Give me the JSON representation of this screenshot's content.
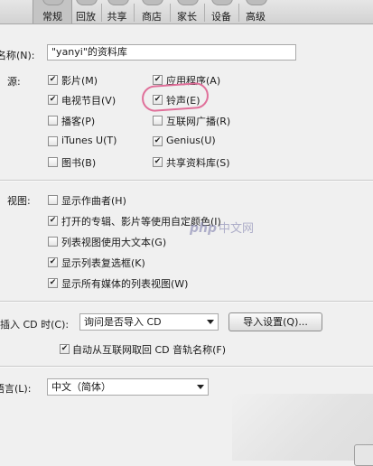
{
  "toolbar": {
    "tabs": [
      {
        "label": "常规",
        "icon": "gear-icon"
      },
      {
        "label": "回放",
        "icon": "playback-icon"
      },
      {
        "label": "共享",
        "icon": "share-icon"
      },
      {
        "label": "商店",
        "icon": "store-icon"
      },
      {
        "label": "家长",
        "icon": "parental-icon"
      },
      {
        "label": "设备",
        "icon": "device-icon"
      },
      {
        "label": "高级",
        "icon": "advanced-icon"
      }
    ],
    "active": "常规"
  },
  "library_name": {
    "label": "名称(N):",
    "value": "\"yanyi\"的资料库"
  },
  "sources": {
    "label": "源:",
    "items": [
      {
        "label": "影片(M)",
        "checked": true
      },
      {
        "label": "应用程序(A)",
        "checked": true
      },
      {
        "label": "电视节目(V)",
        "checked": true
      },
      {
        "label": "铃声(E)",
        "checked": true
      },
      {
        "label": "播客(P)",
        "checked": false
      },
      {
        "label": "互联网广播(R)",
        "checked": false
      },
      {
        "label": "iTunes U(T)",
        "checked": false
      },
      {
        "label": "Genius(U)",
        "checked": true
      },
      {
        "label": "图书(B)",
        "checked": false
      },
      {
        "label": "共享资料库(S)",
        "checked": true
      }
    ]
  },
  "views": {
    "label": "视图:",
    "items": [
      {
        "label": "显示作曲者(H)",
        "checked": false
      },
      {
        "label": "打开的专辑、影片等使用自定颜色(I)",
        "checked": true
      },
      {
        "label": "列表视图使用大文本(G)",
        "checked": false
      },
      {
        "label": "显示列表复选框(K)",
        "checked": true
      },
      {
        "label": "显示所有媒体的列表视图(W)",
        "checked": true
      }
    ]
  },
  "cd_insert": {
    "label": "插入 CD 时(C):",
    "value": "询问是否导入 CD",
    "import_settings_button": "导入设置(Q)...",
    "auto_names": {
      "label": "自动从互联网取回 CD 音轨名称(F)",
      "checked": true
    }
  },
  "language": {
    "label": "语言(L):",
    "value": "中文（简体）"
  },
  "watermark": {
    "latin": "php",
    "cn": "中文网"
  }
}
